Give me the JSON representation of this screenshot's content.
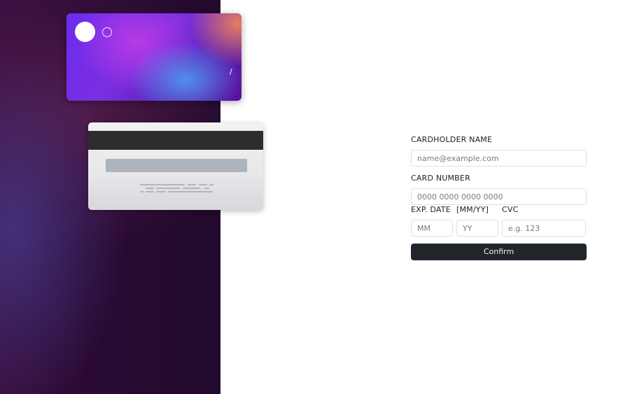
{
  "card_front": {
    "separator": "/"
  },
  "form": {
    "cardholder_label": "CARDHOLDER NAME",
    "cardholder_placeholder": "name@example.com",
    "number_label": "CARD NUMBER",
    "number_placeholder": "0000 0000 0000 0000",
    "exp_label": "EXP. DATE",
    "exp_format_label": "[MM/YY]",
    "cvc_label": "CVC",
    "month_placeholder": "MM",
    "year_placeholder": "YY",
    "cvc_placeholder": "e.g. 123",
    "confirm_label": "Confirm"
  },
  "colors": {
    "confirm_bg": "#212529",
    "left_panel": "#220a2d",
    "card_gradient_start": "#6a2cf0"
  }
}
